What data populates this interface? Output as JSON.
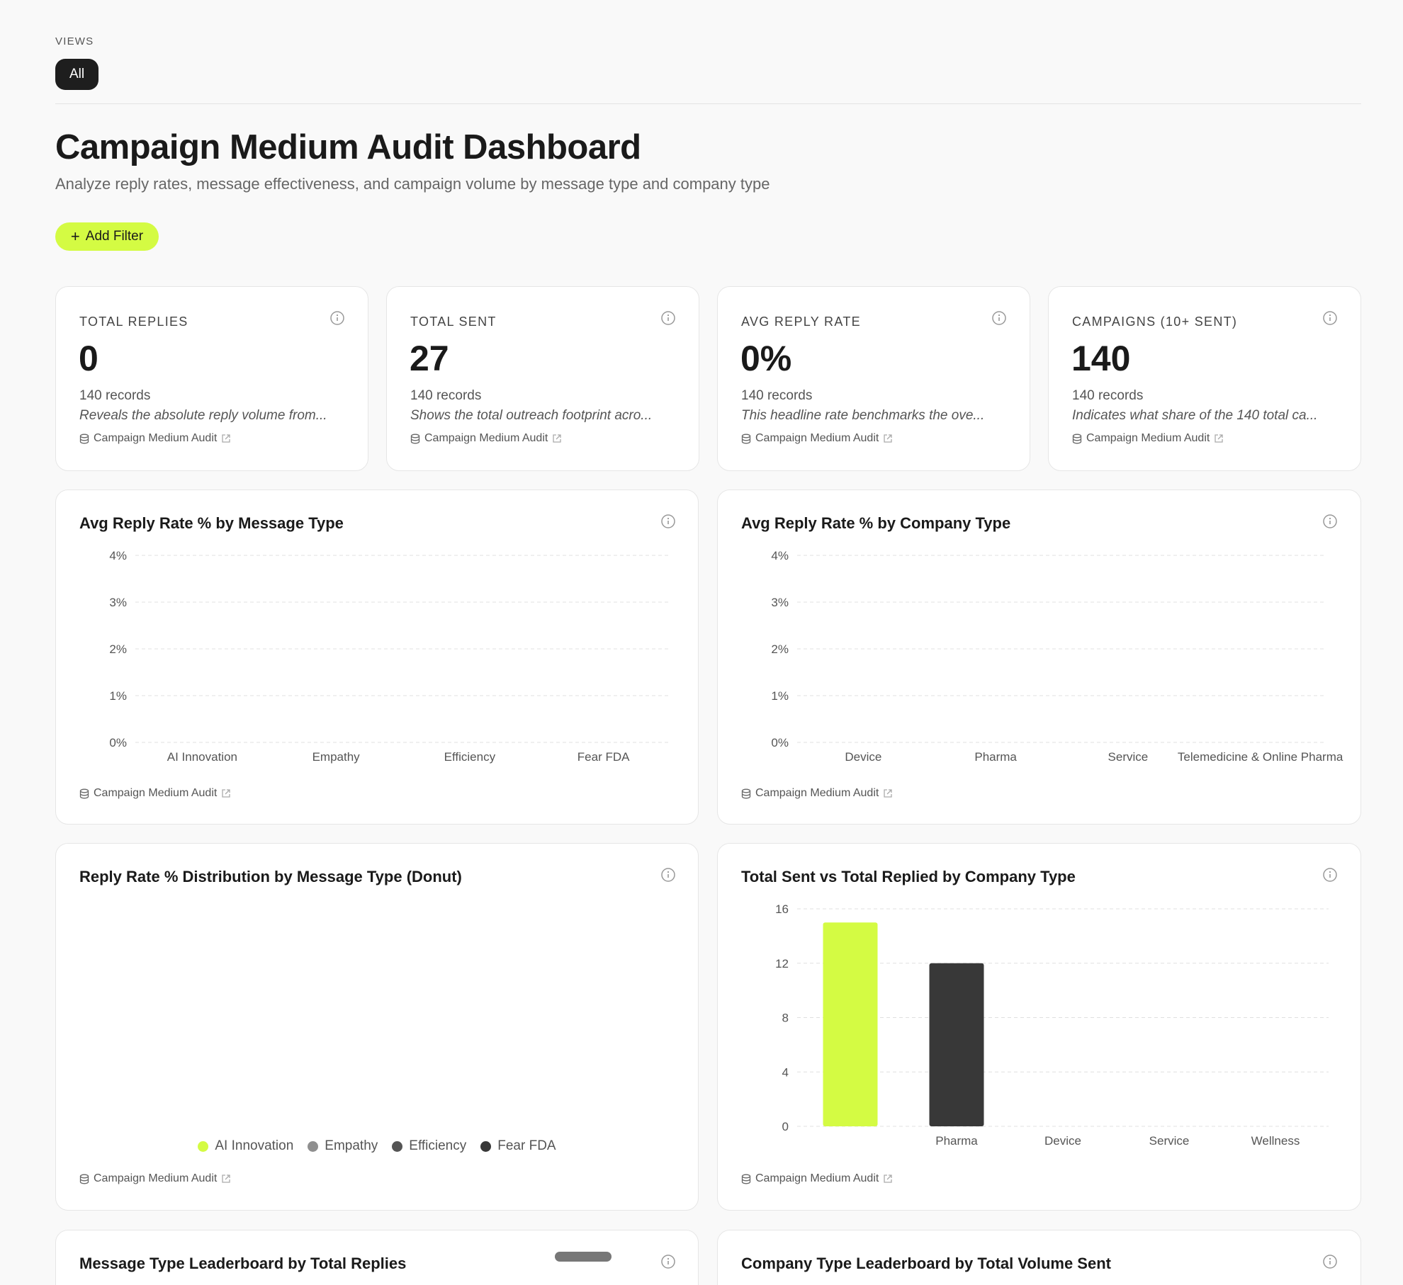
{
  "views": {
    "label": "VIEWS",
    "items": [
      "All"
    ]
  },
  "header": {
    "title": "Campaign Medium Audit Dashboard",
    "subtitle": "Analyze reply rates, message effectiveness, and campaign volume by message type and company type"
  },
  "filter": {
    "add_label": "Add Filter"
  },
  "source_label": "Campaign Medium Audit",
  "kpis": [
    {
      "label": "TOTAL REPLIES",
      "value": "0",
      "records": "140 records",
      "desc": "Reveals the absolute reply volume from..."
    },
    {
      "label": "TOTAL SENT",
      "value": "27",
      "records": "140 records",
      "desc": "Shows the total outreach footprint acro..."
    },
    {
      "label": "AVG REPLY RATE",
      "value": "0%",
      "records": "140 records",
      "desc": "This headline rate benchmarks the ove..."
    },
    {
      "label": "CAMPAIGNS (10+ SENT)",
      "value": "140",
      "records": "140 records",
      "desc": "Indicates what share of the 140 total ca..."
    }
  ],
  "charts": {
    "by_message": {
      "title": "Avg Reply Rate % by Message Type"
    },
    "by_company": {
      "title": "Avg Reply Rate % by Company Type"
    },
    "donut": {
      "title": "Reply Rate % Distribution by Message Type (Donut)"
    },
    "sent_vs_replied": {
      "title": "Total Sent vs Total Replied by Company Type"
    },
    "msg_leaderboard": {
      "title": "Message Type Leaderboard by Total Replies"
    },
    "company_leaderboard": {
      "title": "Company Type Leaderboard by Total Volume Sent"
    }
  },
  "colors": {
    "accent": "#d4fb43",
    "dark": "#383838"
  },
  "chart_data": [
    {
      "type": "bar",
      "title": "Avg Reply Rate % by Message Type",
      "categories": [
        "AI Innovation",
        "Empathy",
        "Efficiency",
        "Fear FDA"
      ],
      "values": [
        0,
        0,
        0,
        0
      ],
      "yticks": [
        "0%",
        "1%",
        "2%",
        "3%",
        "4%"
      ],
      "ylim": [
        0,
        4
      ],
      "grid": true
    },
    {
      "type": "bar",
      "title": "Avg Reply Rate % by Company Type",
      "categories": [
        "Device",
        "Pharma",
        "Service",
        "Telemedicine & Online Pharma"
      ],
      "values": [
        0,
        0,
        0,
        0
      ],
      "yticks": [
        "0%",
        "1%",
        "2%",
        "3%",
        "4%"
      ],
      "ylim": [
        0,
        4
      ],
      "grid": true
    },
    {
      "type": "pie",
      "title": "Reply Rate % Distribution by Message Type (Donut)",
      "categories": [
        "AI Innovation",
        "Empathy",
        "Efficiency",
        "Fear FDA"
      ],
      "colors": [
        "#d4fb43",
        "#8f8f8f",
        "#555555",
        "#383838"
      ],
      "values": [
        0,
        0,
        0,
        0
      ],
      "legend": "bottom"
    },
    {
      "type": "bar",
      "title": "Total Sent vs Total Replied by Company Type",
      "categories": [
        "",
        "Pharma",
        "Device",
        "Service",
        "Wellness"
      ],
      "values": [
        15,
        12,
        0,
        0,
        0
      ],
      "colors": [
        "#d4fb43",
        "#383838",
        "#383838",
        "#383838",
        "#383838"
      ],
      "yticks": [
        "0",
        "4",
        "8",
        "12",
        "16"
      ],
      "ylim": [
        0,
        16
      ],
      "grid": true
    }
  ]
}
